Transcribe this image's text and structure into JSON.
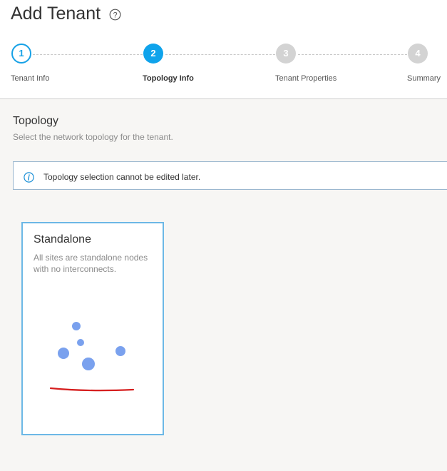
{
  "page": {
    "title": "Add Tenant"
  },
  "stepper": {
    "steps": [
      {
        "number": "1",
        "label": "Tenant Info",
        "state": "done"
      },
      {
        "number": "2",
        "label": "Topology Info",
        "state": "active"
      },
      {
        "number": "3",
        "label": "Tenant Properties",
        "state": "pending"
      },
      {
        "number": "4",
        "label": "Summary",
        "state": "pending"
      }
    ]
  },
  "topology": {
    "title": "Topology",
    "subtitle": "Select the network topology for the tenant.",
    "alert": {
      "icon": "info-icon",
      "text": "Topology selection cannot be edited later."
    },
    "cards": [
      {
        "title": "Standalone",
        "description": "All sites are standalone nodes with no interconnects.",
        "selected": true
      }
    ]
  },
  "colors": {
    "accent": "#0fa3eb",
    "pending_step": "#d3d3d3",
    "node": "#7aa1ee",
    "annotation_underline": "#d61f1f",
    "card_border": "#6cb8e6"
  }
}
